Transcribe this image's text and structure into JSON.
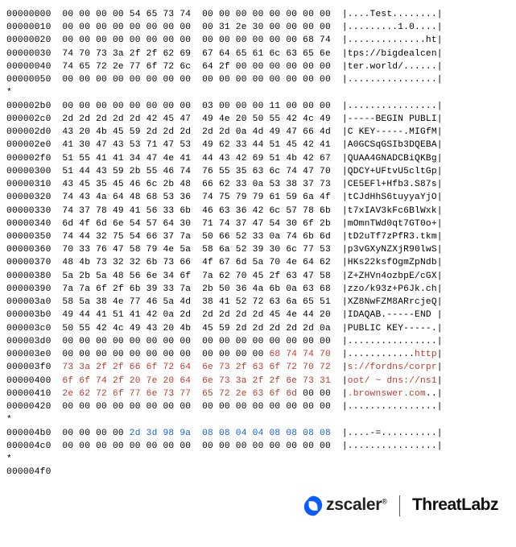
{
  "rows": [
    {
      "offset": "00000000",
      "hex": [
        "00",
        "00",
        "00",
        "00",
        "54",
        "65",
        "73",
        "74",
        "00",
        "00",
        "00",
        "00",
        "00",
        "00",
        "00",
        "00"
      ],
      "ascii": "|....Test........|",
      "colors": []
    },
    {
      "offset": "00000010",
      "hex": [
        "00",
        "00",
        "00",
        "00",
        "00",
        "00",
        "00",
        "00",
        "00",
        "31",
        "2e",
        "30",
        "00",
        "00",
        "00",
        "00"
      ],
      "ascii": "|.........1.0....|",
      "colors": []
    },
    {
      "offset": "00000020",
      "hex": [
        "00",
        "00",
        "00",
        "00",
        "00",
        "00",
        "00",
        "00",
        "00",
        "00",
        "00",
        "00",
        "00",
        "00",
        "68",
        "74"
      ],
      "ascii": "|..............ht|",
      "colors": []
    },
    {
      "offset": "00000030",
      "hex": [
        "74",
        "70",
        "73",
        "3a",
        "2f",
        "2f",
        "62",
        "69",
        "67",
        "64",
        "65",
        "61",
        "6c",
        "63",
        "65",
        "6e"
      ],
      "ascii": "|tps://bigdealcen|",
      "colors": []
    },
    {
      "offset": "00000040",
      "hex": [
        "74",
        "65",
        "72",
        "2e",
        "77",
        "6f",
        "72",
        "6c",
        "64",
        "2f",
        "00",
        "00",
        "00",
        "00",
        "00",
        "00"
      ],
      "ascii": "|ter.world/......|",
      "colors": []
    },
    {
      "offset": "00000050",
      "hex": [
        "00",
        "00",
        "00",
        "00",
        "00",
        "00",
        "00",
        "00",
        "00",
        "00",
        "00",
        "00",
        "00",
        "00",
        "00",
        "00"
      ],
      "ascii": "|................|",
      "colors": []
    },
    {
      "offset": "*",
      "hex": [],
      "ascii": "",
      "colors": []
    },
    {
      "offset": "000002b0",
      "hex": [
        "00",
        "00",
        "00",
        "00",
        "00",
        "00",
        "00",
        "00",
        "03",
        "00",
        "00",
        "00",
        "11",
        "00",
        "00",
        "00"
      ],
      "ascii": "|................|",
      "colors": []
    },
    {
      "offset": "000002c0",
      "hex": [
        "2d",
        "2d",
        "2d",
        "2d",
        "2d",
        "42",
        "45",
        "47",
        "49",
        "4e",
        "20",
        "50",
        "55",
        "42",
        "4c",
        "49"
      ],
      "ascii": "|-----BEGIN PUBLI|",
      "colors": []
    },
    {
      "offset": "000002d0",
      "hex": [
        "43",
        "20",
        "4b",
        "45",
        "59",
        "2d",
        "2d",
        "2d",
        "2d",
        "2d",
        "0a",
        "4d",
        "49",
        "47",
        "66",
        "4d"
      ],
      "ascii": "|C KEY-----.MIGfM|",
      "colors": []
    },
    {
      "offset": "000002e0",
      "hex": [
        "41",
        "30",
        "47",
        "43",
        "53",
        "71",
        "47",
        "53",
        "49",
        "62",
        "33",
        "44",
        "51",
        "45",
        "42",
        "41"
      ],
      "ascii": "|A0GCSqGSIb3DQEBA|",
      "colors": []
    },
    {
      "offset": "000002f0",
      "hex": [
        "51",
        "55",
        "41",
        "41",
        "34",
        "47",
        "4e",
        "41",
        "44",
        "43",
        "42",
        "69",
        "51",
        "4b",
        "42",
        "67"
      ],
      "ascii": "|QUAA4GNADCBiQKBg|",
      "colors": []
    },
    {
      "offset": "00000300",
      "hex": [
        "51",
        "44",
        "43",
        "59",
        "2b",
        "55",
        "46",
        "74",
        "76",
        "55",
        "35",
        "63",
        "6c",
        "74",
        "47",
        "70"
      ],
      "ascii": "|QDCY+UFtvU5cltGp|",
      "colors": []
    },
    {
      "offset": "00000310",
      "hex": [
        "43",
        "45",
        "35",
        "45",
        "46",
        "6c",
        "2b",
        "48",
        "66",
        "62",
        "33",
        "0a",
        "53",
        "38",
        "37",
        "73"
      ],
      "ascii": "|CE5EFl+Hfb3.S87s|",
      "colors": []
    },
    {
      "offset": "00000320",
      "hex": [
        "74",
        "43",
        "4a",
        "64",
        "48",
        "68",
        "53",
        "36",
        "74",
        "75",
        "79",
        "79",
        "61",
        "59",
        "6a",
        "4f"
      ],
      "ascii": "|tCJdHhS6tuyyaYjO|",
      "colors": []
    },
    {
      "offset": "00000330",
      "hex": [
        "74",
        "37",
        "78",
        "49",
        "41",
        "56",
        "33",
        "6b",
        "46",
        "63",
        "36",
        "42",
        "6c",
        "57",
        "78",
        "6b"
      ],
      "ascii": "|t7xIAV3kFc6BlWxk|",
      "colors": []
    },
    {
      "offset": "00000340",
      "hex": [
        "6d",
        "4f",
        "6d",
        "6e",
        "54",
        "57",
        "64",
        "30",
        "71",
        "74",
        "37",
        "47",
        "54",
        "30",
        "6f",
        "2b"
      ],
      "ascii": "|mOmnTWd0qt7GT0o+|",
      "colors": []
    },
    {
      "offset": "00000350",
      "hex": [
        "74",
        "44",
        "32",
        "75",
        "54",
        "66",
        "37",
        "7a",
        "50",
        "66",
        "52",
        "33",
        "0a",
        "74",
        "6b",
        "6d"
      ],
      "ascii": "|tD2uTf7zPfR3.tkm|",
      "colors": []
    },
    {
      "offset": "00000360",
      "hex": [
        "70",
        "33",
        "76",
        "47",
        "58",
        "79",
        "4e",
        "5a",
        "58",
        "6a",
        "52",
        "39",
        "30",
        "6c",
        "77",
        "53"
      ],
      "ascii": "|p3vGXyNZXjR90lwS|",
      "colors": []
    },
    {
      "offset": "00000370",
      "hex": [
        "48",
        "4b",
        "73",
        "32",
        "32",
        "6b",
        "73",
        "66",
        "4f",
        "67",
        "6d",
        "5a",
        "70",
        "4e",
        "64",
        "62"
      ],
      "ascii": "|HKs22ksfOgmZpNdb|",
      "colors": []
    },
    {
      "offset": "00000380",
      "hex": [
        "5a",
        "2b",
        "5a",
        "48",
        "56",
        "6e",
        "34",
        "6f",
        "7a",
        "62",
        "70",
        "45",
        "2f",
        "63",
        "47",
        "58"
      ],
      "ascii": "|Z+ZHVn4ozbpE/cGX|",
      "colors": []
    },
    {
      "offset": "00000390",
      "hex": [
        "7a",
        "7a",
        "6f",
        "2f",
        "6b",
        "39",
        "33",
        "7a",
        "2b",
        "50",
        "36",
        "4a",
        "6b",
        "0a",
        "63",
        "68"
      ],
      "ascii": "|zzo/k93z+P6Jk.ch|",
      "colors": []
    },
    {
      "offset": "000003a0",
      "hex": [
        "58",
        "5a",
        "38",
        "4e",
        "77",
        "46",
        "5a",
        "4d",
        "38",
        "41",
        "52",
        "72",
        "63",
        "6a",
        "65",
        "51"
      ],
      "ascii": "|XZ8NwFZM8ARrcjeQ|",
      "colors": []
    },
    {
      "offset": "000003b0",
      "hex": [
        "49",
        "44",
        "41",
        "51",
        "41",
        "42",
        "0a",
        "2d",
        "2d",
        "2d",
        "2d",
        "2d",
        "45",
        "4e",
        "44",
        "20"
      ],
      "ascii": "|IDAQAB.-----END |",
      "colors": []
    },
    {
      "offset": "000003c0",
      "hex": [
        "50",
        "55",
        "42",
        "4c",
        "49",
        "43",
        "20",
        "4b",
        "45",
        "59",
        "2d",
        "2d",
        "2d",
        "2d",
        "2d",
        "0a"
      ],
      "ascii": "|PUBLIC KEY-----.|",
      "colors": []
    },
    {
      "offset": "000003d0",
      "hex": [
        "00",
        "00",
        "00",
        "00",
        "00",
        "00",
        "00",
        "00",
        "00",
        "00",
        "00",
        "00",
        "00",
        "00",
        "00",
        "00"
      ],
      "ascii": "|................|",
      "colors": []
    },
    {
      "offset": "000003e0",
      "hex": [
        "00",
        "00",
        "00",
        "00",
        "00",
        "00",
        "00",
        "00",
        "00",
        "00",
        "00",
        "00",
        "68",
        "74",
        "74",
        "70"
      ],
      "ascii_parts": [
        {
          "t": "|............",
          "c": ""
        },
        {
          "t": "http",
          "c": "red"
        },
        {
          "t": "|",
          "c": ""
        }
      ],
      "hexcolors": {
        "12": "red",
        "13": "red",
        "14": "red",
        "15": "red"
      }
    },
    {
      "offset": "000003f0",
      "hex": [
        "73",
        "3a",
        "2f",
        "2f",
        "66",
        "6f",
        "72",
        "64",
        "6e",
        "73",
        "2f",
        "63",
        "6f",
        "72",
        "70",
        "72"
      ],
      "ascii_parts": [
        {
          "t": "|",
          "c": ""
        },
        {
          "t": "s://fordns/corpr",
          "c": "red"
        },
        {
          "t": "|",
          "c": ""
        }
      ],
      "hexcolors": "allred"
    },
    {
      "offset": "00000400",
      "hex": [
        "6f",
        "6f",
        "74",
        "2f",
        "20",
        "7e",
        "20",
        "64",
        "6e",
        "73",
        "3a",
        "2f",
        "2f",
        "6e",
        "73",
        "31"
      ],
      "ascii_parts": [
        {
          "t": "|",
          "c": ""
        },
        {
          "t": "oot/ ~ dns://ns1",
          "c": "red"
        },
        {
          "t": "|",
          "c": ""
        }
      ],
      "hexcolors": "allred"
    },
    {
      "offset": "00000410",
      "hex": [
        "2e",
        "62",
        "72",
        "6f",
        "77",
        "6e",
        "73",
        "77",
        "65",
        "72",
        "2e",
        "63",
        "6f",
        "6d",
        "00",
        "00"
      ],
      "ascii_parts": [
        {
          "t": "|",
          "c": ""
        },
        {
          "t": ".brownswer.com",
          "c": "red"
        },
        {
          "t": "..|",
          "c": ""
        }
      ],
      "hexcolors": {
        "0": "red",
        "1": "red",
        "2": "red",
        "3": "red",
        "4": "red",
        "5": "red",
        "6": "red",
        "7": "red",
        "8": "red",
        "9": "red",
        "10": "red",
        "11": "red",
        "12": "red",
        "13": "red"
      }
    },
    {
      "offset": "00000420",
      "hex": [
        "00",
        "00",
        "00",
        "00",
        "00",
        "00",
        "00",
        "00",
        "00",
        "00",
        "00",
        "00",
        "00",
        "00",
        "00",
        "00"
      ],
      "ascii": "|................|",
      "colors": []
    },
    {
      "offset": "*",
      "hex": [],
      "ascii": "",
      "colors": []
    },
    {
      "offset": "000004b0",
      "hex": [
        "00",
        "00",
        "00",
        "00",
        "2d",
        "3d",
        "98",
        "9a",
        "08",
        "08",
        "04",
        "04",
        "08",
        "08",
        "08",
        "08"
      ],
      "ascii": "|....-=..........|",
      "hexcolors": {
        "4": "blue",
        "5": "blue",
        "6": "blue",
        "7": "blue",
        "8": "blue",
        "9": "blue",
        "10": "blue",
        "11": "blue",
        "12": "blue",
        "13": "blue",
        "14": "blue",
        "15": "blue"
      }
    },
    {
      "offset": "000004c0",
      "hex": [
        "00",
        "00",
        "00",
        "00",
        "00",
        "00",
        "00",
        "00",
        "00",
        "00",
        "00",
        "00",
        "00",
        "00",
        "00",
        "00"
      ],
      "ascii": "|................|",
      "colors": []
    },
    {
      "offset": "*",
      "hex": [],
      "ascii": "",
      "colors": []
    },
    {
      "offset": "000004f0",
      "hex": [],
      "ascii": "",
      "colors": []
    }
  ],
  "logos": {
    "zscaler": "zscaler",
    "threatlabz": "ThreatLabz"
  }
}
